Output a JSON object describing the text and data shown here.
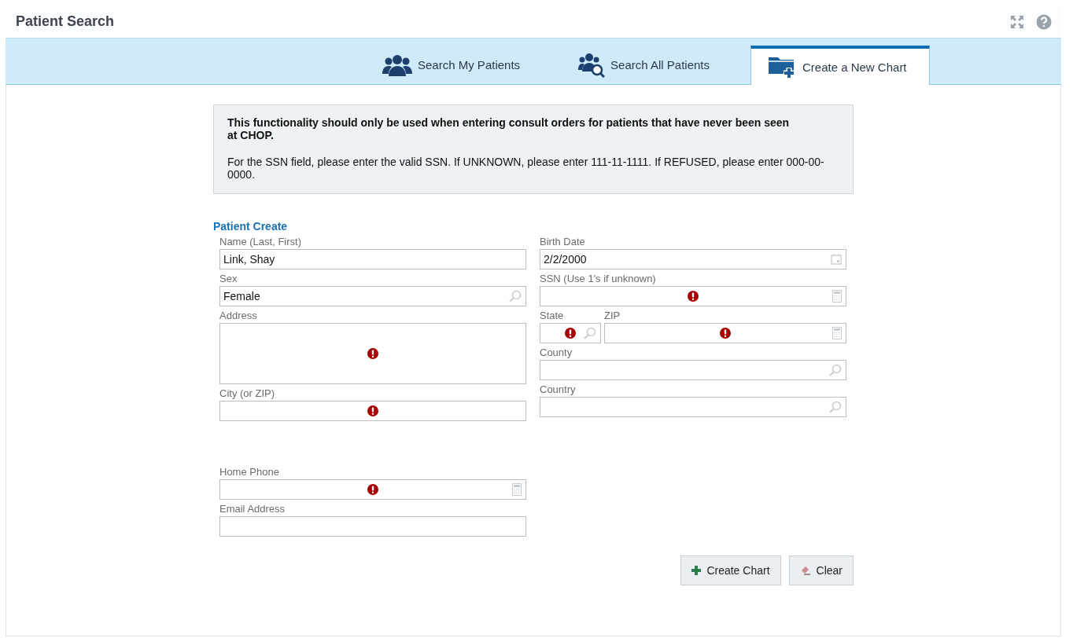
{
  "header": {
    "title": "Patient Search"
  },
  "tabs": [
    {
      "label": "Search My Patients",
      "selected": false
    },
    {
      "label": "Search All Patients",
      "selected": false
    },
    {
      "label": "Create a New Chart",
      "selected": true
    }
  ],
  "notice": {
    "heading": "This functionality should only be used when entering consult orders for patients that have never been seen at CHOP.",
    "body": "For the SSN field, please enter the valid SSN. If UNKNOWN, please enter 111-11-1111. If REFUSED, please enter 000-00-0000."
  },
  "form": {
    "title": "Patient Create",
    "left_fields": [
      {
        "label": "Name (Last, First)",
        "value": "Link, Shay",
        "kind": "text",
        "error": false
      },
      {
        "label": "Sex",
        "value": "Female",
        "kind": "lookup",
        "error": false
      },
      {
        "label": "Address",
        "kind": "multiline",
        "error": true
      },
      {
        "label": "City (or ZIP)",
        "kind": "text",
        "error": true
      }
    ],
    "left_lower_fields": [
      {
        "label": "Home Phone",
        "kind": "keypad",
        "error": true
      },
      {
        "label": "Email Address",
        "kind": "text",
        "error": false
      }
    ],
    "right_fields": [
      {
        "label": "Birth Date",
        "value": "2/2/2000",
        "kind": "calendar",
        "error": false
      },
      {
        "label": "SSN (Use 1's if unknown)",
        "kind": "keypad",
        "error": true
      },
      {
        "kind": "row",
        "fields": [
          {
            "label": "State",
            "kind": "lookup",
            "error": true
          },
          {
            "label": "ZIP",
            "kind": "keypad",
            "error": true
          }
        ]
      },
      {
        "label": "County",
        "kind": "lookup",
        "error": false
      },
      {
        "label": "Country",
        "kind": "lookup",
        "error": false
      }
    ]
  },
  "buttons": [
    {
      "label": "Create Chart"
    },
    {
      "label": "Clear"
    }
  ]
}
